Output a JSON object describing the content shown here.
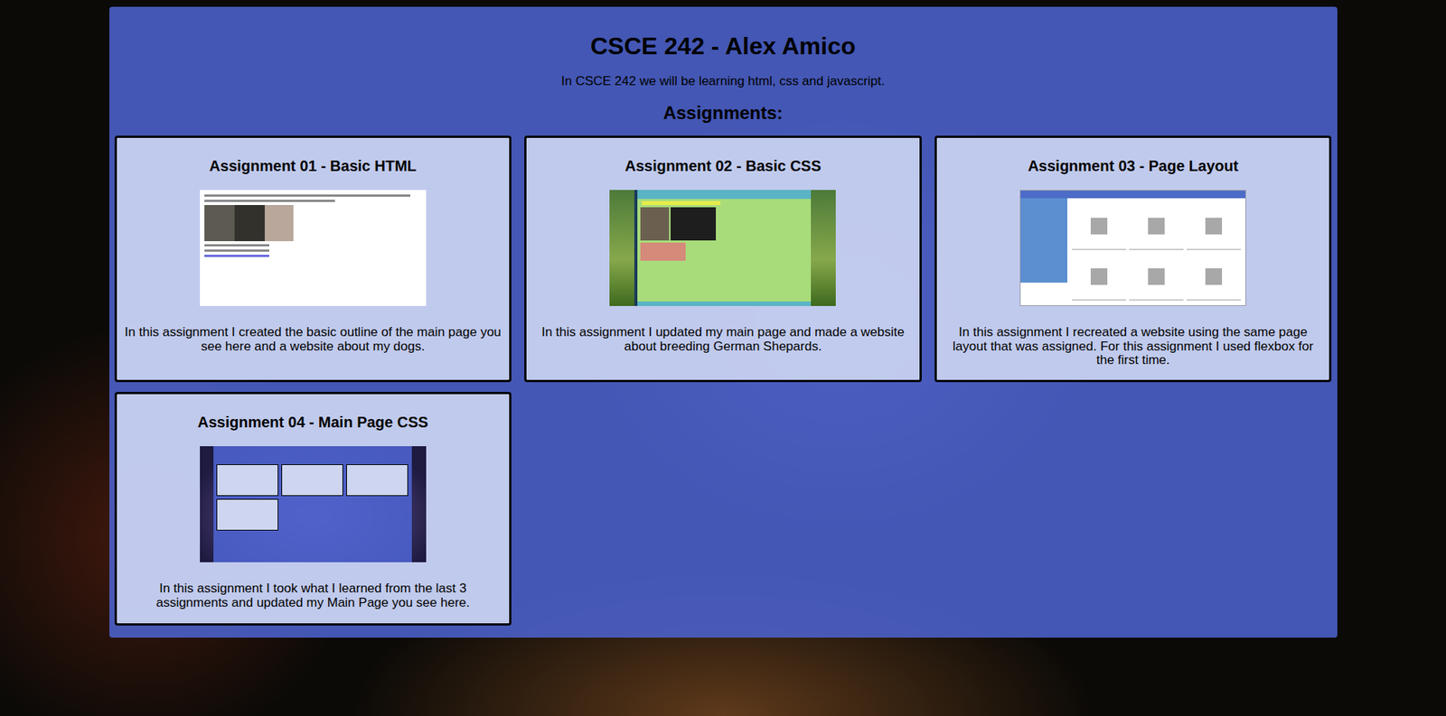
{
  "header": {
    "title": "CSCE 242 - Alex Amico",
    "intro": "In CSCE 242 we will be learning html, css and javascript.",
    "section_title": "Assignments:"
  },
  "assignments": [
    {
      "title": "Assignment 01 - Basic HTML",
      "description": "In this assignment I created the basic outline of the main page you see here and a website about my dogs.",
      "thumbnail": {
        "kind": "plain"
      }
    },
    {
      "title": "Assignment 02 - Basic CSS",
      "description": "In this assignment I updated my main page and made a website about breeding German Shepards.",
      "thumbnail": {
        "kind": "green"
      }
    },
    {
      "title": "Assignment 03 - Page Layout",
      "description": "In this assignment I recreated a website using the same page layout that was assigned. For this assignment I used flexbox for the first time.",
      "thumbnail": {
        "kind": "layout"
      }
    },
    {
      "title": "Assignment 04 - Main Page CSS",
      "description": "In this assignment I took what I learned from the last 3 assignments and updated my Main Page you see here.",
      "thumbnail": {
        "kind": "main"
      }
    }
  ]
}
